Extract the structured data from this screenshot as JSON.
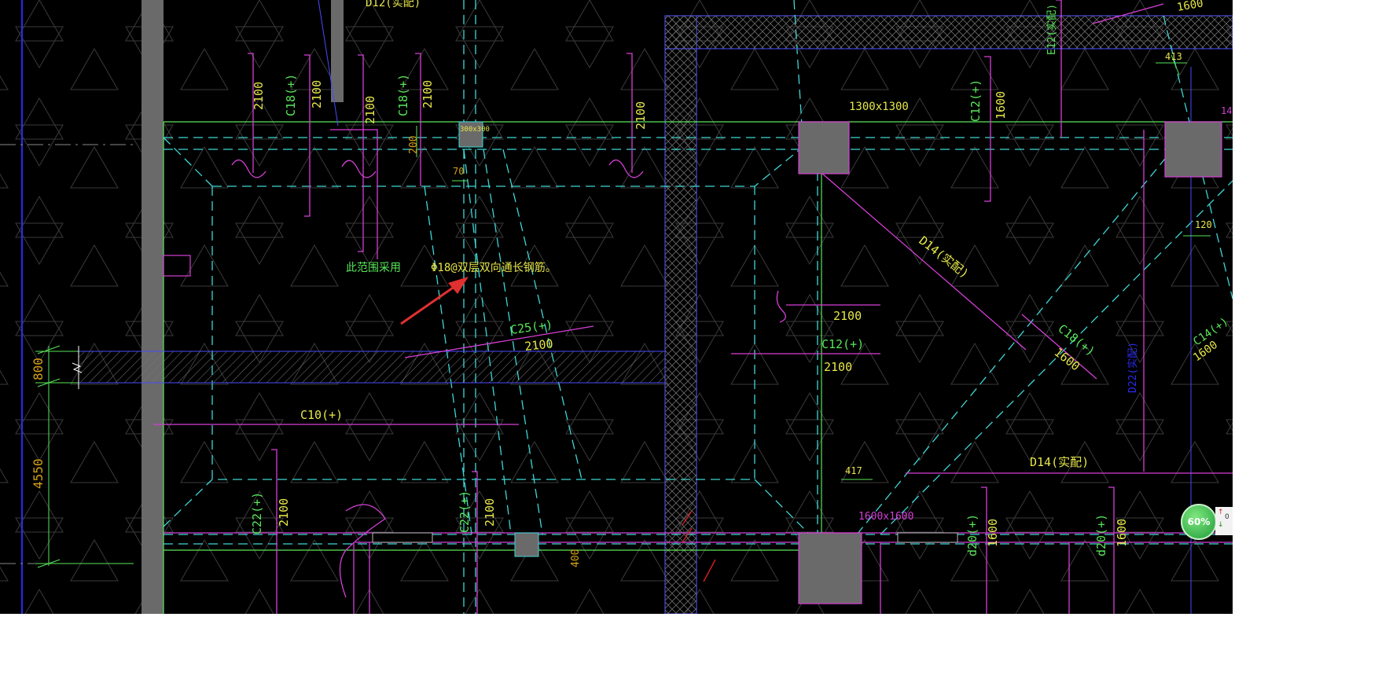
{
  "colors": {
    "background": "#000000",
    "green": "#59e659",
    "yellow": "#e6e64a",
    "magenta": "#d63fd6",
    "cyan": "#3fd6d6",
    "blue": "#2a2af0",
    "column_gray": "#6a6a6a"
  },
  "annotation": {
    "note_left": "此范围采用",
    "note_main": "Φ18@双层双向通长钢筋。"
  },
  "labels": {
    "d12_top": "D12(实配)",
    "c18_a": "C18(+)",
    "c18_b": "C18(+)",
    "l2100_a": "2100",
    "l2100_b": "2100",
    "l2100_c": "2100",
    "l2100_d": "2100",
    "l2100_e": "2100",
    "l1300": "1300x1300",
    "c12_top": "C12(+)",
    "l1600_a": "1600",
    "e12_top": "E12(实配)",
    "l1600_top": "1600",
    "l413": "413",
    "l14_edge": "14",
    "l200": "200",
    "l70": "70",
    "l120": "120",
    "l_box300": "300x300",
    "d14_diag": "D14(实配)",
    "c25": "C25(+)",
    "l2100_c25": "2100",
    "l2100_mid": "2100",
    "c12_mid": "C12(+)",
    "l2100_mid2": "2100",
    "c18_diag": "C18(+)",
    "l1600_diag": "1600",
    "c14_edge": "C14(+)",
    "l1600_edge": "1600",
    "d22": "D22(实配)",
    "dim_800": "800",
    "dim_4550": "4550",
    "c10": "C10(+)",
    "d14_bottom": "D14(实配)",
    "l417": "417",
    "l1600x1600": "1600x1600",
    "c22_a": "C22(+)",
    "l2100_c22a": "2100",
    "c22_b": "C22(+)",
    "l2100_c22b": "2100",
    "l400": "400",
    "d20_a": "d20(+)",
    "l1600_d20a": "1600",
    "d20_b": "d20(+)",
    "l1600_d20b": "1600"
  },
  "zoom": {
    "percent": "60%",
    "side_value": "0"
  }
}
